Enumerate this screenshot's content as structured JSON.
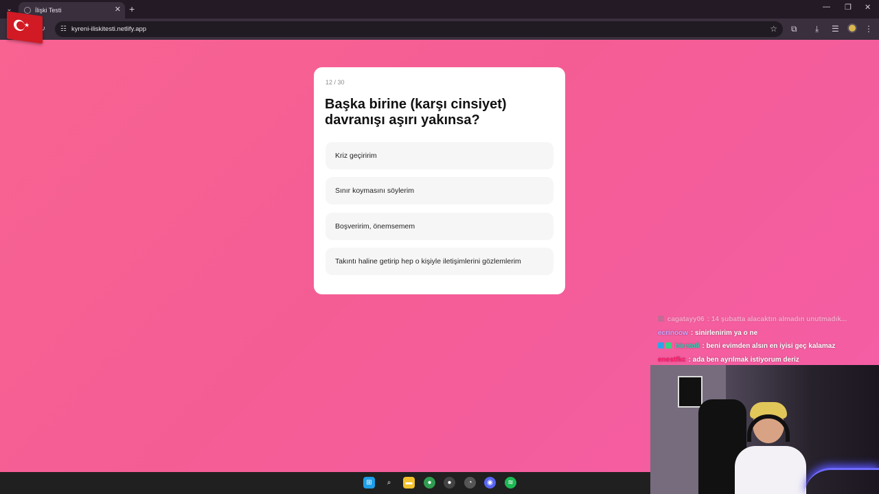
{
  "browser": {
    "tab_title": "İlişki Testi",
    "url": "kyreni-iliskitesti.netlify.app"
  },
  "quiz": {
    "progress": "12 / 30",
    "question": "Başka birine (karşı cinsiyet) davranışı aşırı yakınsa?",
    "answers": [
      "Kriz geçiririm",
      "Sınır koymasını söylerim",
      "Boşveririm, önemsemem",
      "Takıntı haline getirip hep o kişiyle iletişimlerini gözlemlerim"
    ]
  },
  "chat": {
    "messages": [
      {
        "user": "cagatayy06",
        "text": ": 14 şubatta alacaktın almadın unutmadık...",
        "color": "#b9a7c4",
        "faded": true
      },
      {
        "user": "ecrinoow",
        "text": ": sinirlenirim ya o ne",
        "color": "#c8a8ff",
        "faded": false
      },
      {
        "user": "bientoli",
        "text": ": beni evimden alsın en iyisi geç kalamaz",
        "color": "#2cd3b4",
        "faded": false
      },
      {
        "user": "enestfkc",
        "text": ": ada ben ayrılmak istiyorum deriz",
        "color": "#ff1b6b",
        "faded": false
      }
    ]
  },
  "colors": {
    "page_gradient_start": "#f86392",
    "page_gradient_end": "#f55da7",
    "card": "#ffffff",
    "answer_bg": "#f6f6f6"
  },
  "icons": {
    "tab_list": "chevron-down-icon",
    "reload": "reload-icon",
    "site_info": "site-info-icon",
    "bookmark": "star-icon",
    "extensions": "puzzle-icon",
    "downloads": "download-icon",
    "media": "media-controls-icon"
  }
}
